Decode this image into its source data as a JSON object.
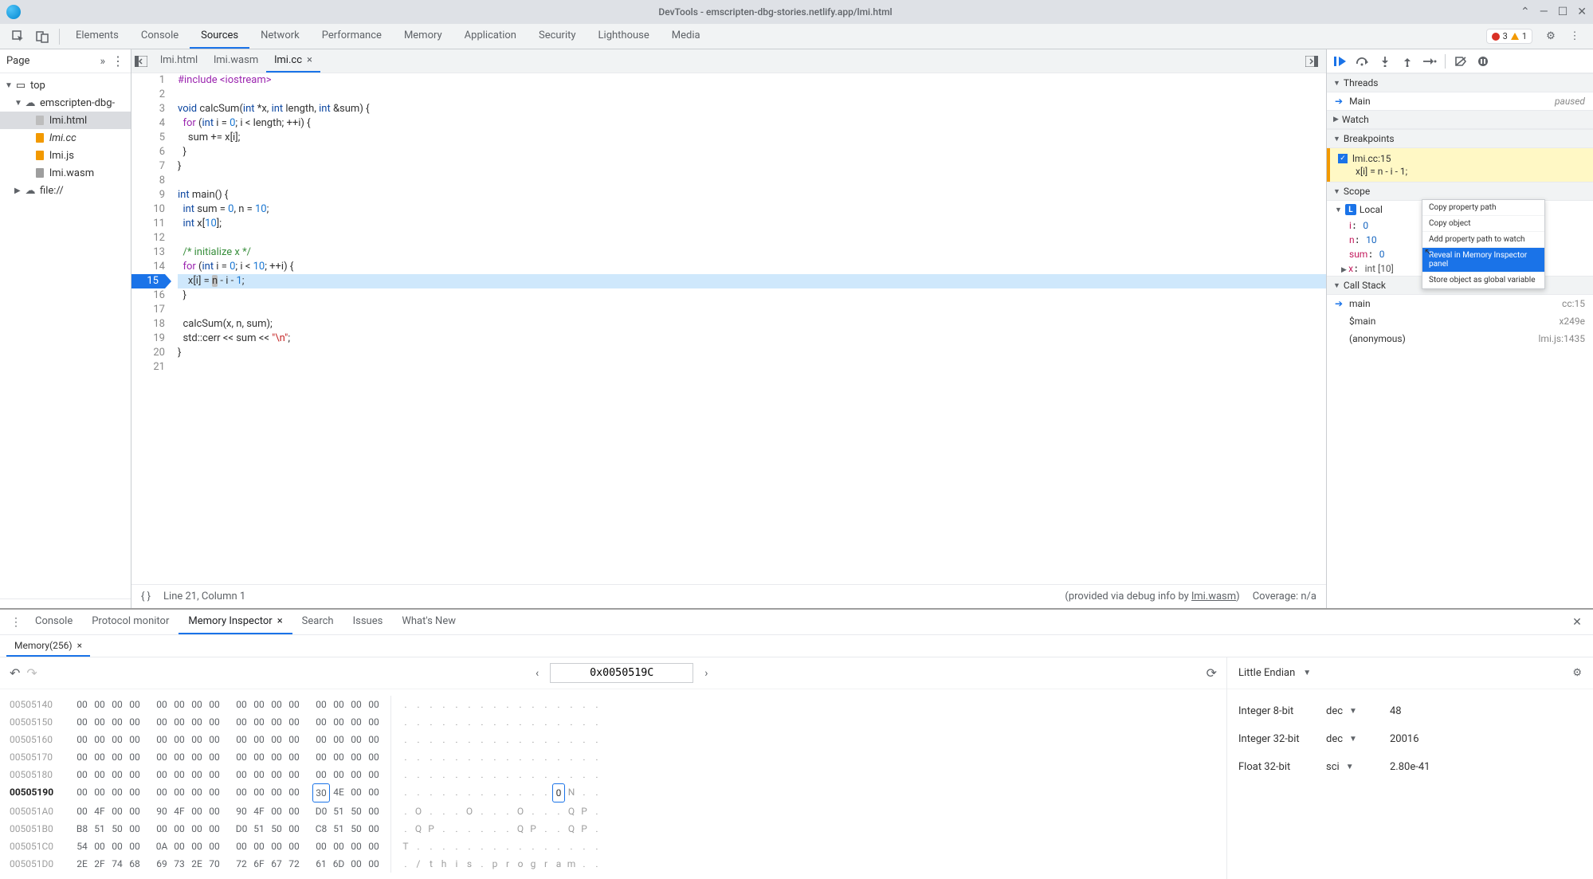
{
  "titlebar": {
    "title": "DevTools - emscripten-dbg-stories.netlify.app/lmi.html"
  },
  "main_tabs": [
    "Elements",
    "Console",
    "Sources",
    "Network",
    "Performance",
    "Memory",
    "Application",
    "Security",
    "Lighthouse",
    "Media"
  ],
  "main_tab_active": "Sources",
  "error_count": "3",
  "warning_count": "1",
  "page_label": "Page",
  "file_tree": {
    "top": "top",
    "domain": "emscripten-dbg-",
    "files": [
      "lmi.html",
      "lmi.cc",
      "lmi.js",
      "lmi.wasm"
    ],
    "extra": "file://"
  },
  "editor_tabs": [
    "lmi.html",
    "lmi.wasm",
    "lmi.cc"
  ],
  "editor_active": "lmi.cc",
  "code": {
    "l1": "#include <iostream>",
    "l2": "",
    "l3_a": "void",
    "l3_b": " calcSum(",
    "l3_c": "int",
    "l3_d": " *x, ",
    "l3_e": "int",
    "l3_f": " length, ",
    "l3_g": "int",
    "l3_h": " &sum) {",
    "l4_a": "  for",
    "l4_b": " (",
    "l4_c": "int",
    "l4_d": " i = ",
    "l4_e": "0",
    "l4_f": "; i < length; ++i) {",
    "l5": "    sum += x[i];",
    "l6": "  }",
    "l7": "}",
    "l8": "",
    "l9_a": "int",
    "l9_b": " main() {",
    "l10_a": "  int",
    "l10_b": " sum = ",
    "l10_c": "0",
    "l10_d": ", n = ",
    "l10_e": "10",
    "l10_f": ";",
    "l11_a": "  int",
    "l11_b": " x[",
    "l11_c": "10",
    "l11_d": "];",
    "l12": "",
    "l13": "  /* initialize x */",
    "l14_a": "  for",
    "l14_b": " (",
    "l14_c": "int",
    "l14_d": " i = ",
    "l14_e": "0",
    "l14_f": "; i < ",
    "l14_g": "10",
    "l14_h": "; ++i) {",
    "l15_a": "    x[i] = ",
    "l15_b": "n",
    "l15_c": " - i - ",
    "l15_d": "1",
    "l15_e": ";",
    "l16": "  }",
    "l17": "",
    "l18": "  calcSum(x, n, sum);",
    "l19_a": "  std::cerr << sum << ",
    "l19_b": "\"\\n\"",
    "l19_c": ";",
    "l20": "}",
    "l21": ""
  },
  "status": {
    "pos": "Line 21, Column 1",
    "provided": "(provided via debug info by ",
    "wasm": "lmi.wasm",
    "close": ")",
    "coverage": "Coverage: n/a"
  },
  "debugger": {
    "threads": "Threads",
    "thread_main": "Main",
    "thread_status": "paused",
    "watch": "Watch",
    "breakpoints": "Breakpoints",
    "bp_file": "lmi.cc:15",
    "bp_code": "x[i] = n - i - 1;",
    "scope": "Scope",
    "local": "Local",
    "var_i": "i",
    "val_i": "0",
    "var_n": "n",
    "val_n": "10",
    "var_sum": "sum",
    "val_sum": "0",
    "var_x": "x",
    "val_x": "int [10]",
    "callstack": "Call Stack",
    "frame_main": "main",
    "frame_main_loc": "cc:15",
    "frame_smain": "$main",
    "frame_smain_loc": "x249e",
    "frame_anon": "(anonymous)",
    "frame_anon_loc": "lmi.js:1435"
  },
  "context_menu": {
    "i1": "Copy property path",
    "i2": "Copy object",
    "i3": "Add property path to watch",
    "i4": "Reveal in Memory Inspector panel",
    "i5": "Store object as global variable"
  },
  "drawer_tabs": [
    "Console",
    "Protocol monitor",
    "Memory Inspector",
    "Search",
    "Issues",
    "What's New"
  ],
  "drawer_active": "Memory Inspector",
  "mem_subtab": "Memory(256)",
  "mem_address": "0x0050519C",
  "hex": {
    "rows": [
      {
        "addr": "00505140",
        "bold": false,
        "bytes": [
          "00",
          "00",
          "00",
          "00",
          "00",
          "00",
          "00",
          "00",
          "00",
          "00",
          "00",
          "00",
          "00",
          "00",
          "00",
          "00"
        ],
        "ascii": [
          ".",
          ".",
          ".",
          ".",
          ".",
          ".",
          ".",
          ".",
          ".",
          ".",
          ".",
          ".",
          ".",
          ".",
          ".",
          "."
        ]
      },
      {
        "addr": "00505150",
        "bold": false,
        "bytes": [
          "00",
          "00",
          "00",
          "00",
          "00",
          "00",
          "00",
          "00",
          "00",
          "00",
          "00",
          "00",
          "00",
          "00",
          "00",
          "00"
        ],
        "ascii": [
          ".",
          ".",
          ".",
          ".",
          ".",
          ".",
          ".",
          ".",
          ".",
          ".",
          ".",
          ".",
          ".",
          ".",
          ".",
          "."
        ]
      },
      {
        "addr": "00505160",
        "bold": false,
        "bytes": [
          "00",
          "00",
          "00",
          "00",
          "00",
          "00",
          "00",
          "00",
          "00",
          "00",
          "00",
          "00",
          "00",
          "00",
          "00",
          "00"
        ],
        "ascii": [
          ".",
          ".",
          ".",
          ".",
          ".",
          ".",
          ".",
          ".",
          ".",
          ".",
          ".",
          ".",
          ".",
          ".",
          ".",
          "."
        ]
      },
      {
        "addr": "00505170",
        "bold": false,
        "bytes": [
          "00",
          "00",
          "00",
          "00",
          "00",
          "00",
          "00",
          "00",
          "00",
          "00",
          "00",
          "00",
          "00",
          "00",
          "00",
          "00"
        ],
        "ascii": [
          ".",
          ".",
          ".",
          ".",
          ".",
          ".",
          ".",
          ".",
          ".",
          ".",
          ".",
          ".",
          ".",
          ".",
          ".",
          "."
        ]
      },
      {
        "addr": "00505180",
        "bold": false,
        "bytes": [
          "00",
          "00",
          "00",
          "00",
          "00",
          "00",
          "00",
          "00",
          "00",
          "00",
          "00",
          "00",
          "00",
          "00",
          "00",
          "00"
        ],
        "ascii": [
          ".",
          ".",
          ".",
          ".",
          ".",
          ".",
          ".",
          ".",
          ".",
          ".",
          ".",
          ".",
          ".",
          ".",
          ".",
          "."
        ]
      },
      {
        "addr": "00505190",
        "bold": true,
        "bytes": [
          "00",
          "00",
          "00",
          "00",
          "00",
          "00",
          "00",
          "00",
          "00",
          "00",
          "00",
          "00",
          "30",
          "4E",
          "00",
          "00"
        ],
        "hl_byte": 12,
        "ascii": [
          ".",
          ".",
          ".",
          ".",
          ".",
          ".",
          ".",
          ".",
          ".",
          ".",
          ".",
          ".",
          "0",
          "N",
          ".",
          "."
        ],
        "hl_ascii": 12
      },
      {
        "addr": "005051A0",
        "bold": false,
        "bytes": [
          "00",
          "4F",
          "00",
          "00",
          "90",
          "4F",
          "00",
          "00",
          "90",
          "4F",
          "00",
          "00",
          "D0",
          "51",
          "50",
          "00"
        ],
        "ascii": [
          ".",
          "O",
          ".",
          ".",
          ".",
          "O",
          ".",
          ".",
          ".",
          "O",
          ".",
          ".",
          ".",
          "Q",
          "P",
          "."
        ]
      },
      {
        "addr": "005051B0",
        "bold": false,
        "bytes": [
          "B8",
          "51",
          "50",
          "00",
          "00",
          "00",
          "00",
          "00",
          "D0",
          "51",
          "50",
          "00",
          "C8",
          "51",
          "50",
          "00"
        ],
        "ascii": [
          ".",
          "Q",
          "P",
          ".",
          ".",
          ".",
          ".",
          ".",
          ".",
          "Q",
          "P",
          ".",
          ".",
          "Q",
          "P",
          "."
        ]
      },
      {
        "addr": "005051C0",
        "bold": false,
        "bytes": [
          "54",
          "00",
          "00",
          "00",
          "0A",
          "00",
          "00",
          "00",
          "00",
          "00",
          "00",
          "00",
          "00",
          "00",
          "00",
          "00"
        ],
        "ascii": [
          "T",
          ".",
          ".",
          ".",
          ".",
          ".",
          ".",
          ".",
          ".",
          ".",
          ".",
          ".",
          ".",
          ".",
          ".",
          "."
        ]
      },
      {
        "addr": "005051D0",
        "bold": false,
        "bytes": [
          "2E",
          "2F",
          "74",
          "68",
          "69",
          "73",
          "2E",
          "70",
          "72",
          "6F",
          "67",
          "72",
          "61",
          "6D",
          "00",
          "00"
        ],
        "ascii": [
          ".",
          "/",
          "t",
          "h",
          "i",
          "s",
          ".",
          "p",
          "r",
          "o",
          "g",
          "r",
          "a",
          "m",
          ".",
          "."
        ]
      }
    ]
  },
  "endian": "Little Endian",
  "values": [
    {
      "label": "Integer 8-bit",
      "repr": "dec",
      "val": "48"
    },
    {
      "label": "Integer 32-bit",
      "repr": "dec",
      "val": "20016"
    },
    {
      "label": "Float 32-bit",
      "repr": "sci",
      "val": "2.80e-41"
    }
  ]
}
